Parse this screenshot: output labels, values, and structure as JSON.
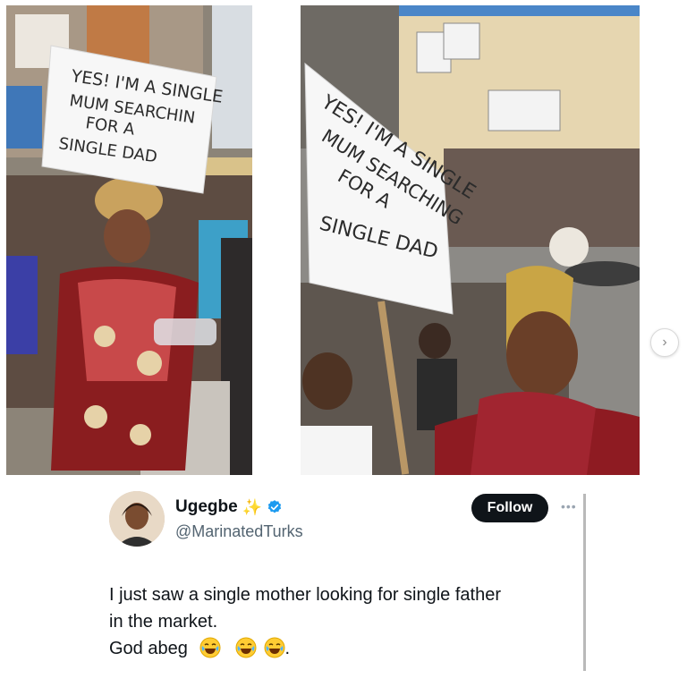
{
  "photos": {
    "left_sign_lines": [
      "YES! I'M A SINGLE",
      "MUM SEARCHIN",
      "FOR A",
      "SINGLE DAD"
    ],
    "right_sign_lines": [
      "YES! I'M A SINGLE",
      "MUM SEARCHING",
      "FOR A",
      "SINGLE DAD"
    ]
  },
  "carousel": {
    "next_icon": "chevron-right-icon",
    "next_glyph": "›"
  },
  "tweet": {
    "display_name": "Ugegbe",
    "sparkle": "✨",
    "handle": "@MarinatedTurks",
    "follow_label": "Follow",
    "more_glyph": "•••",
    "lines": [
      "I just saw a single mother looking for single father",
      "in the market.",
      "God abeg"
    ],
    "trailing_punct": ".",
    "emoji_count": 3,
    "emoji_icon": "face-with-tears-of-joy-icon"
  },
  "colors": {
    "follow_bg": "#0f1419",
    "verified": "#1d9bf0",
    "handle": "#536471"
  }
}
